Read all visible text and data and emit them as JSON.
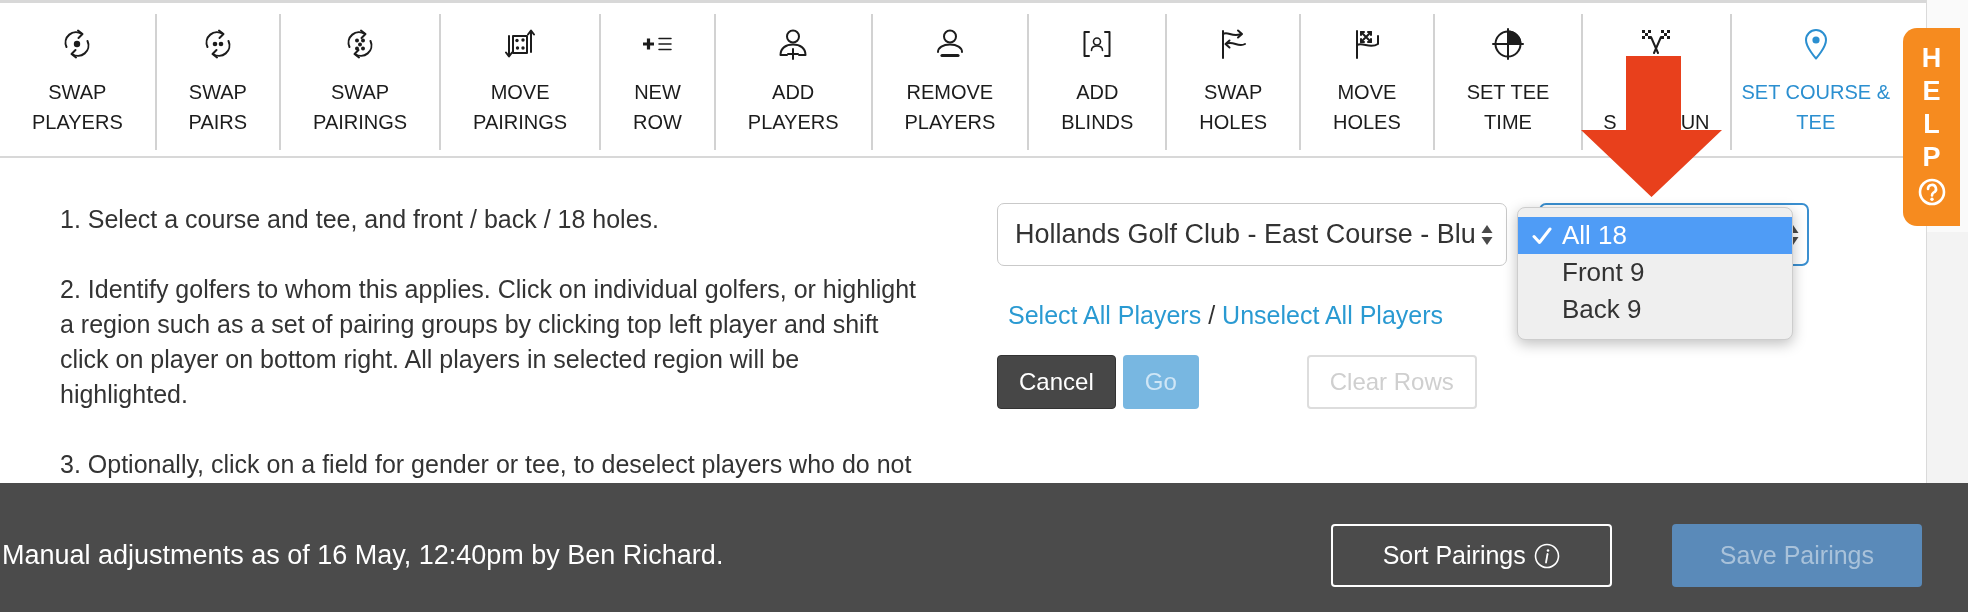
{
  "toolbar": {
    "tools": [
      {
        "label_lines": [
          "SWAP",
          "PLAYERS"
        ],
        "selected": false
      },
      {
        "label_lines": [
          "SWAP",
          "PAIRS"
        ],
        "selected": false
      },
      {
        "label_lines": [
          "SWAP",
          "PAIRINGS"
        ],
        "selected": false
      },
      {
        "label_lines": [
          "MOVE",
          "PAIRINGS"
        ],
        "selected": false
      },
      {
        "label_lines": [
          "NEW",
          "ROW"
        ],
        "selected": false
      },
      {
        "label_lines": [
          "ADD",
          "PLAYERS"
        ],
        "selected": false
      },
      {
        "label_lines": [
          "REMOVE",
          "PLAYERS"
        ],
        "selected": false
      },
      {
        "label_lines": [
          "ADD",
          "BLINDS"
        ],
        "selected": false
      },
      {
        "label_lines": [
          "SWAP",
          "HOLES"
        ],
        "selected": false
      },
      {
        "label_lines": [
          "MOVE",
          "HOLES"
        ],
        "selected": false
      },
      {
        "label_lines": [
          "SET TEE",
          "TIME"
        ],
        "selected": false
      },
      {
        "label_visible_parts": [
          "S",
          "UN"
        ],
        "selected": false
      },
      {
        "label_lines": [
          "SET COURSE &",
          "TEE"
        ],
        "selected": true
      }
    ]
  },
  "help_tab": {
    "label": "HELP"
  },
  "instructions": [
    "1. Select a course and tee, and front / back / 18 holes.",
    "2. Identify golfers to whom this applies. Click on individual golfers, or highlight a region such as a set of pairing groups by clicking top left player and shift click on player on bottom right. All players in selected region will be highlighted.",
    "3. Optionally, click on a field for gender or tee, to deselect players who do not"
  ],
  "course_select": {
    "value": "Hollands Golf Club - East Course - Blu"
  },
  "holes_select": {
    "expanded": true,
    "options": [
      {
        "label": "All 18",
        "selected": true
      },
      {
        "label": "Front 9",
        "selected": false
      },
      {
        "label": "Back 9",
        "selected": false
      }
    ]
  },
  "player_links": {
    "links": [
      "Select All Players",
      "Unselect All Players"
    ],
    "separator": "/"
  },
  "buttons": [
    {
      "label": "Cancel",
      "kind": "primary",
      "disabled": false
    },
    {
      "label": "Go",
      "kind": "accent",
      "disabled": true
    },
    {
      "label": "Clear Rows",
      "kind": "outline",
      "disabled": true
    }
  ],
  "status_bar": {
    "message": "Manual adjustments as of 16 May, 12:40pm by Ben Richard.",
    "buttons": [
      {
        "label": "Sort Pairings",
        "kind": "outline",
        "info": true,
        "disabled": false
      },
      {
        "label": "Save Pairings",
        "kind": "accent",
        "info": false,
        "disabled": true
      }
    ]
  }
}
